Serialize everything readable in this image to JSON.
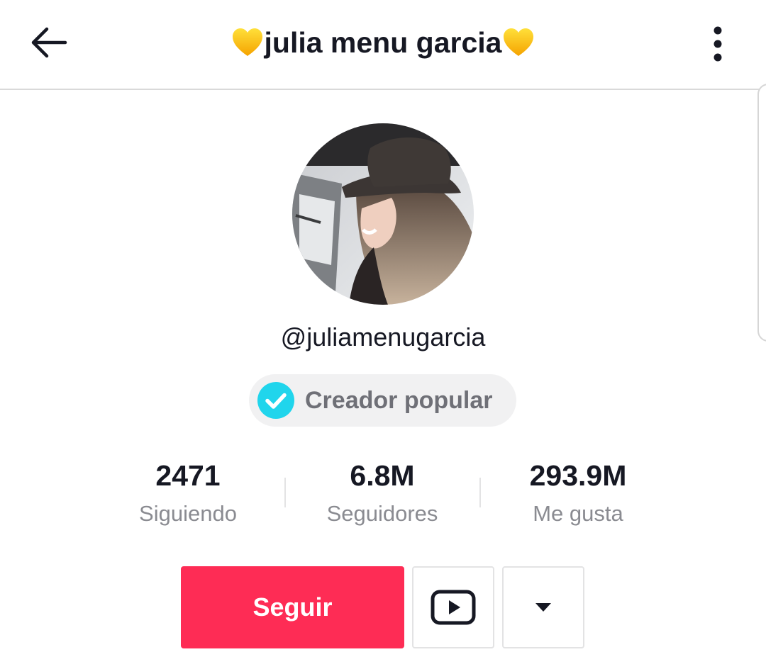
{
  "header": {
    "title": "julia menu garcia",
    "title_emoji": "yellow-heart-emoji",
    "back_icon": "arrow-left-icon",
    "more_icon": "vertical-dots-icon"
  },
  "profile": {
    "username": "@juliamenugarcia",
    "badge_label": "Creador popular",
    "badge_icon": "verified-check-icon",
    "badge_color": "#20d5ec"
  },
  "stats": [
    {
      "value": "2471",
      "label": "Siguiendo"
    },
    {
      "value": "6.8M",
      "label": "Seguidores"
    },
    {
      "value": "293.9M",
      "label": "Me gusta"
    }
  ],
  "actions": {
    "follow_label": "Seguir",
    "follow_color": "#fe2c55",
    "youtube_icon": "youtube-icon",
    "dropdown_icon": "caret-down-icon"
  }
}
